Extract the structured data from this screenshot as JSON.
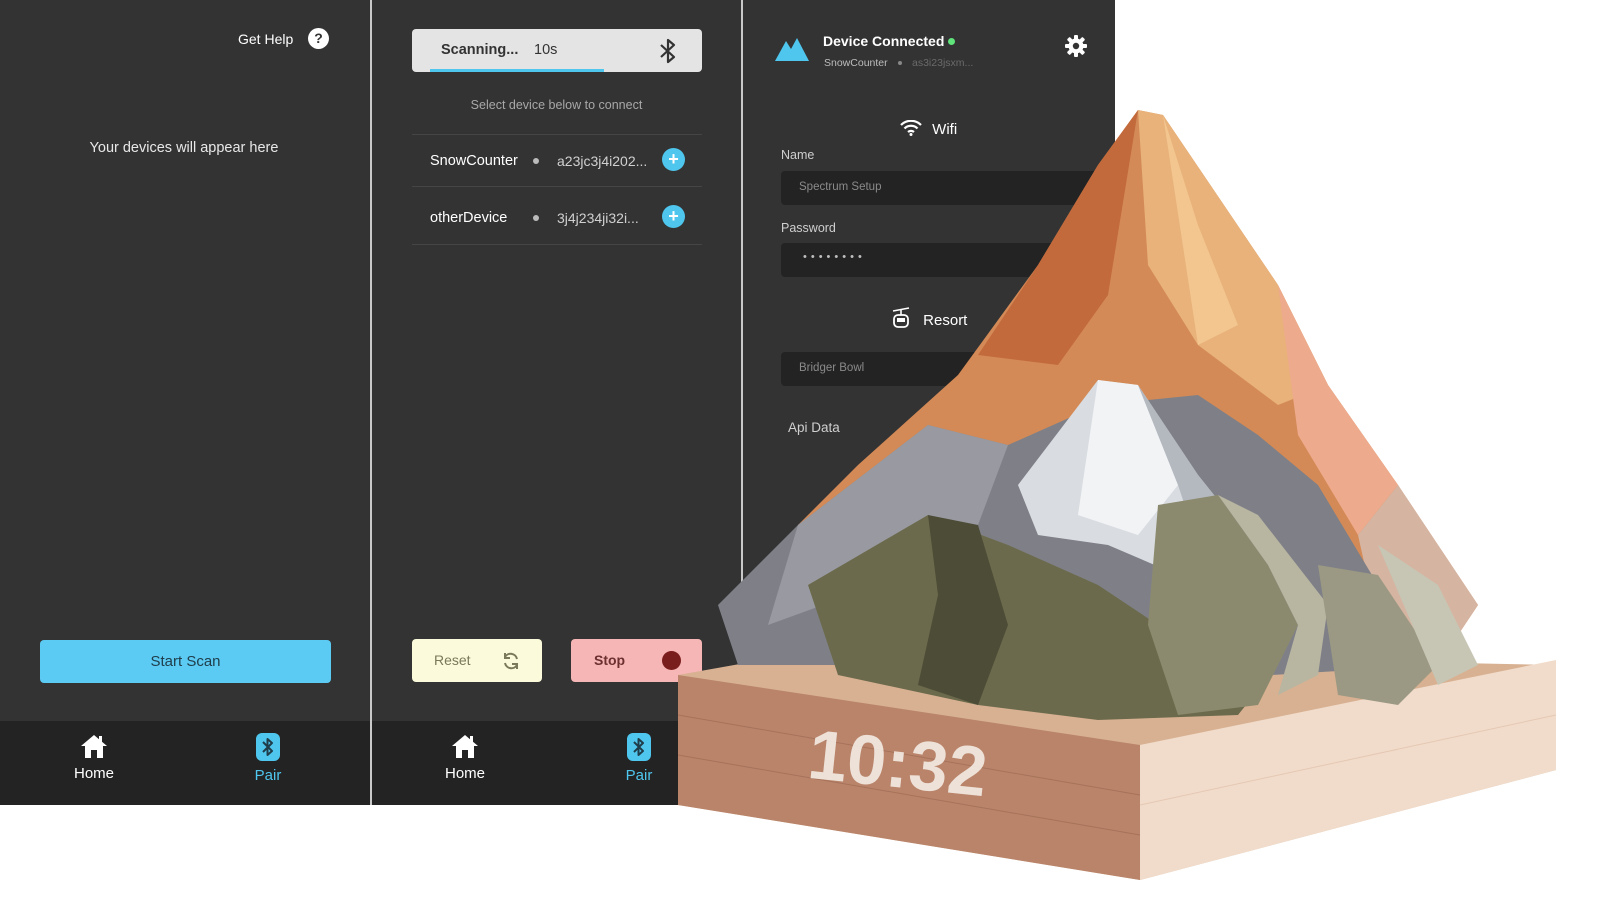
{
  "screen1": {
    "help_label": "Get Help",
    "help_icon": "?",
    "empty_message": "Your devices will appear here",
    "start_scan_label": "Start Scan"
  },
  "screen2": {
    "scan_status": "Scanning...",
    "scan_time": "10s",
    "scan_progress": 0.6,
    "select_message": "Select device below to connect",
    "devices": [
      {
        "name": "SnowCounter",
        "id": "a23jc3j4i202..."
      },
      {
        "name": "otherDevice",
        "id": "3j4j234ji32i..."
      }
    ],
    "add_icon": "+",
    "reset_label": "Reset",
    "stop_label": "Stop"
  },
  "screen3": {
    "connection_title": "Device Connected",
    "device_name": "SnowCounter",
    "device_id": "as3i23jsxm...",
    "wifi_label": "Wifi",
    "name_label": "Name",
    "name_value": "Spectrum Setup",
    "password_label": "Password",
    "password_value": "••••••••",
    "resort_label": "Resort",
    "resort_value": "Bridger Bowl",
    "api_label": "Api Data"
  },
  "nav": {
    "home_label": "Home",
    "pair_label": "Pair"
  },
  "product": {
    "clock_display": "10:32"
  },
  "colors": {
    "accent": "#4fc6ee",
    "panel_bg": "#333333",
    "nav_bg": "#232323",
    "connected": "#5fe37a",
    "reset_bg": "#fbfbdc",
    "stop_bg": "#f7b6b6"
  },
  "icons": [
    "help-icon",
    "bluetooth-icon",
    "add-icon",
    "refresh-icon",
    "stop-record-icon",
    "mountain-logo-icon",
    "gear-icon",
    "wifi-icon",
    "gondola-icon",
    "home-icon"
  ]
}
